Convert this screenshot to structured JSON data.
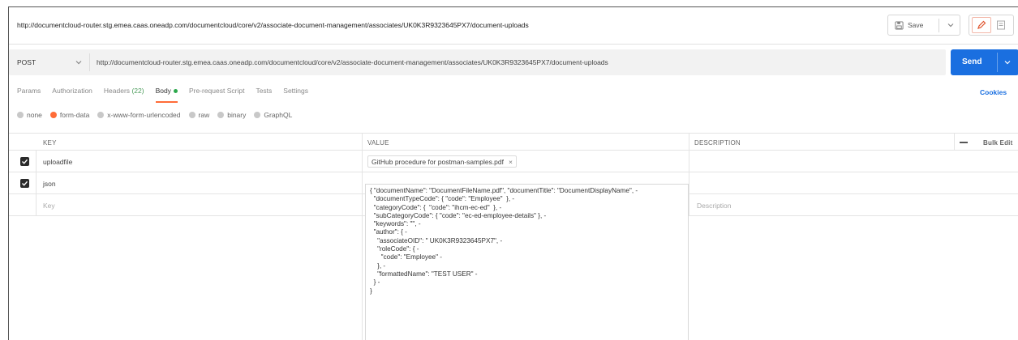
{
  "title_bar": {
    "url": "http://documentcloud-router.stg.emea.caas.oneadp.com/documentcloud/core/v2/associate-document-management/associates/UK0K3R9323645PX7/document-uploads",
    "save_label": "Save"
  },
  "request": {
    "method": "POST",
    "url": "http://documentcloud-router.stg.emea.caas.oneadp.com/documentcloud/core/v2/associate-document-management/associates/UK0K3R9323645PX7/document-uploads",
    "send_label": "Send"
  },
  "tabs": [
    {
      "label": "Params"
    },
    {
      "label": "Authorization"
    },
    {
      "label": "Headers",
      "count": "(22)"
    },
    {
      "label": "Body",
      "active": true
    },
    {
      "label": "Pre-request Script"
    },
    {
      "label": "Tests"
    },
    {
      "label": "Settings"
    }
  ],
  "cookies_label": "Cookies",
  "body_types": [
    {
      "label": "none",
      "selected": false
    },
    {
      "label": "form-data",
      "selected": true
    },
    {
      "label": "x-www-form-urlencoded",
      "selected": false
    },
    {
      "label": "raw",
      "selected": false
    },
    {
      "label": "binary",
      "selected": false
    },
    {
      "label": "GraphQL",
      "selected": false
    }
  ],
  "table": {
    "headers": {
      "key": "KEY",
      "value": "VALUE",
      "description": "DESCRIPTION",
      "bulk_edit": "Bulk Edit"
    },
    "rows": [
      {
        "checked": true,
        "key": "uploadfile",
        "value": "GitHub procedure for postman-samples.pdf"
      },
      {
        "checked": true,
        "key": "json",
        "value": "{ \"documentName\": \"DocumentFileName.pdf\", \"documentTitle\": \"DocumentDisplayName\", -\n  \"documentTypeCode\": { \"code\": \"Employee\"  }, -\n  \"categoryCode\": {  \"code\": \"ihcm-ec-ed\"  }, -\n  \"subCategoryCode\": { \"code\": \"ec-ed-employee-details\" }, -\n  \"keywords\": \"\", -\n  \"author\": { -\n    \"associateOID\": \" UK0K3R9323645PX7\", -\n    \"roleCode\": { -\n      \"code\": \"Employee\" -\n    }, -\n    \"formattedName\": \"TEST USER\" -\n  } -\n}"
      }
    ],
    "placeholder": {
      "key": "Key",
      "description": "Description"
    }
  },
  "colors": {
    "accent": "#ff6c37",
    "send": "#1a6fe0",
    "body_dot": "#2ca84c"
  }
}
